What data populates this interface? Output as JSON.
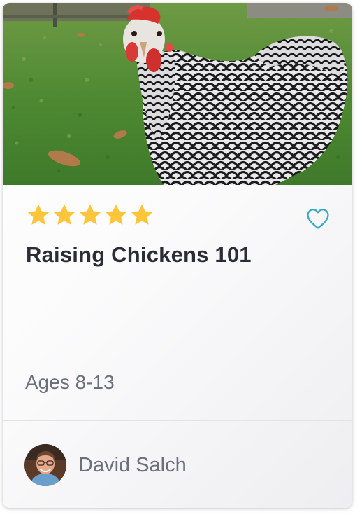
{
  "card": {
    "image_alt": "Silver laced chicken on grass",
    "rating": 5,
    "rating_max": 5,
    "star_color": "#fdc53a",
    "favorite_icon": "heart-outline-icon",
    "accent_color": "#37a9c4",
    "title": "Raising Chickens 101",
    "ages": "Ages 8-13",
    "author": {
      "name": "David Salch",
      "avatar_icon": "avatar"
    }
  }
}
